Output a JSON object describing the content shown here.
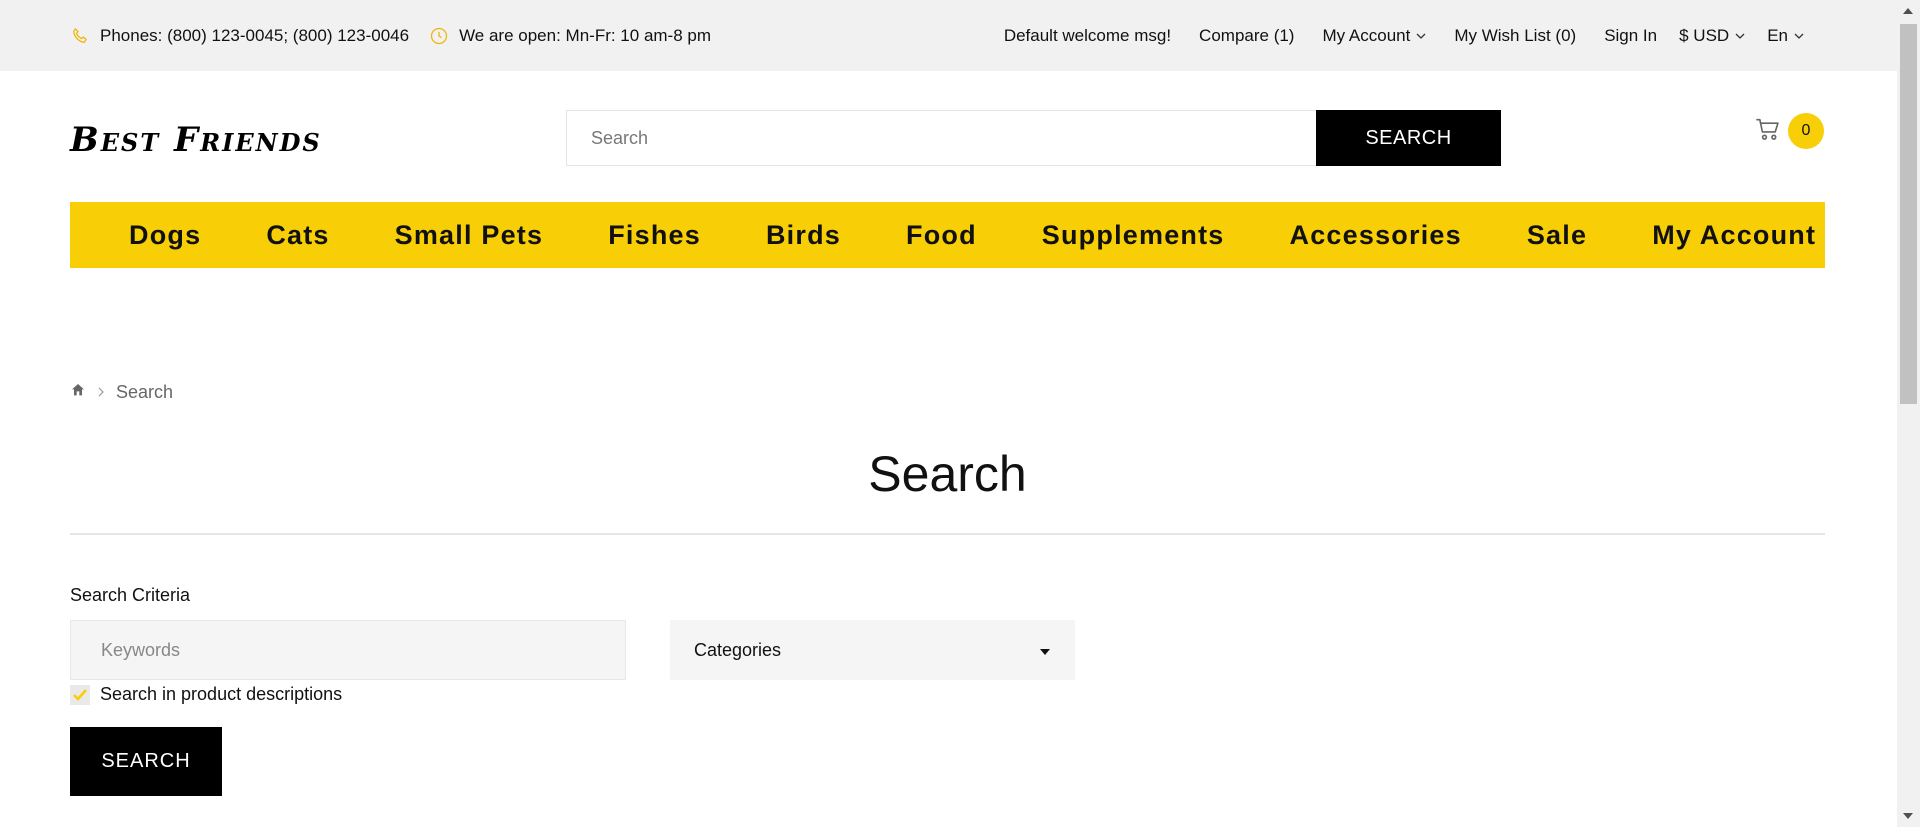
{
  "topbar": {
    "phones": "Phones: (800) 123-0045; (800) 123-0046",
    "hours": "We are open: Mn-Fr: 10 am-8 pm",
    "welcome": "Default welcome msg!",
    "compare": "Compare (1)",
    "my_account": "My Account",
    "wishlist": "My Wish List (0)",
    "sign_in": "Sign In",
    "currency": "$ USD",
    "language": "En"
  },
  "header": {
    "logo": "Best Friends",
    "search_placeholder": "Search",
    "search_button": "SEARCH",
    "cart_count": "0"
  },
  "nav": {
    "items": [
      "Dogs",
      "Cats",
      "Small Pets",
      "Fishes",
      "Birds",
      "Food",
      "Supplements",
      "Accessories",
      "Sale",
      "My Account"
    ]
  },
  "breadcrumb": {
    "current": "Search"
  },
  "main": {
    "title": "Search",
    "criteria_label": "Search Criteria",
    "keywords_placeholder": "Keywords",
    "categories_label": "Categories",
    "checkbox_label": "Search in product descriptions",
    "checkbox_checked": true,
    "submit_label": "SEARCH"
  },
  "colors": {
    "accent": "#f8cf07",
    "dark": "#000000",
    "topbar_bg": "#f1f1f1"
  }
}
